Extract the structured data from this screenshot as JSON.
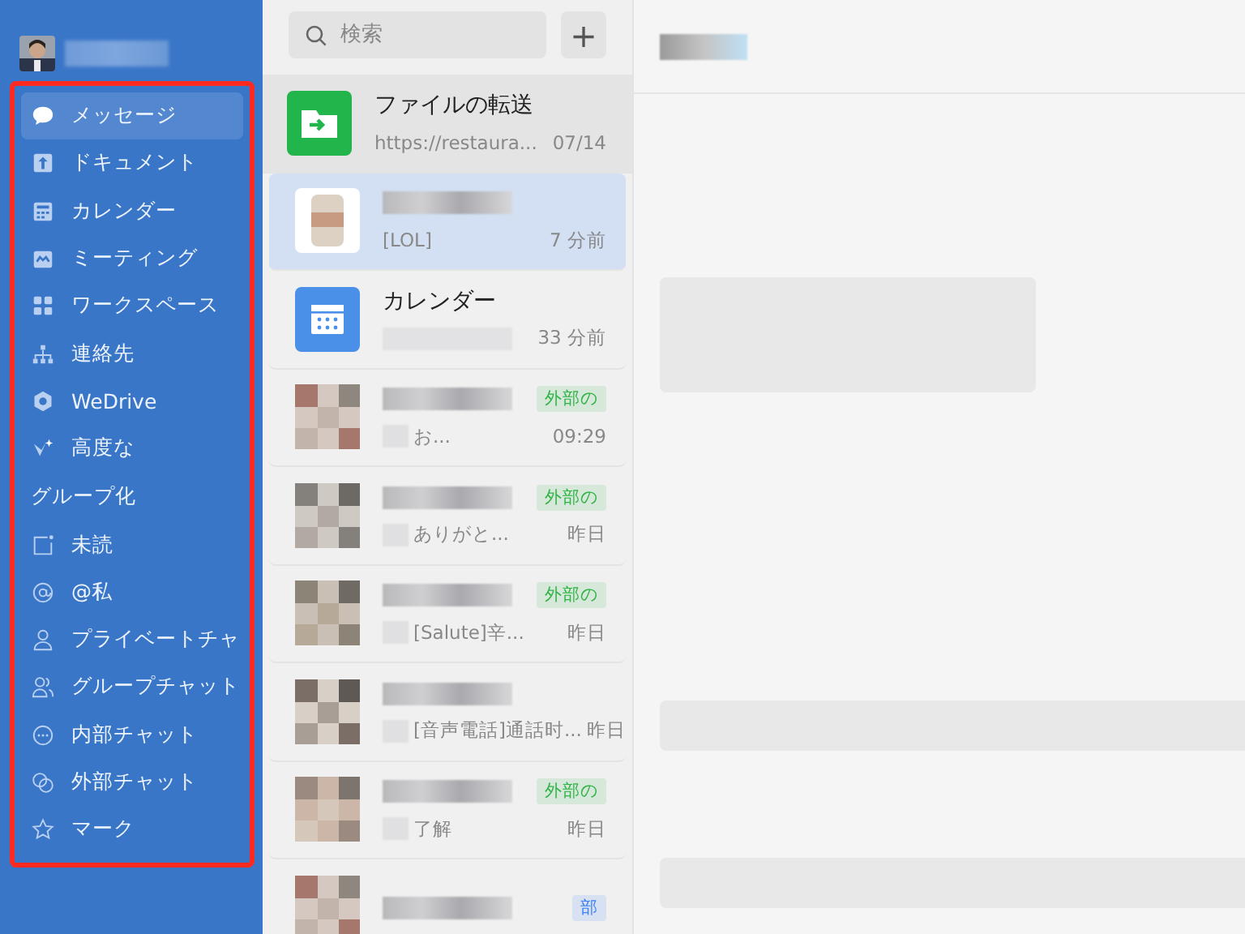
{
  "nav": [
    {
      "kind": "item",
      "label": "メッセージ",
      "selected": true
    },
    {
      "kind": "item",
      "label": "ドキュメント",
      "selected": false
    },
    {
      "kind": "item",
      "label": "カレンダー",
      "selected": false
    },
    {
      "kind": "item",
      "label": "ミーティング",
      "selected": false
    },
    {
      "kind": "item",
      "label": "ワークスペース",
      "selected": false
    },
    {
      "kind": "item",
      "label": "連絡先",
      "selected": false
    },
    {
      "kind": "item",
      "label": "WeDrive",
      "selected": false
    },
    {
      "kind": "item",
      "label": "高度な",
      "selected": false
    },
    {
      "kind": "heading",
      "label": "グループ化"
    },
    {
      "kind": "item",
      "label": "未読",
      "selected": false
    },
    {
      "kind": "item",
      "label": "@私",
      "selected": false
    },
    {
      "kind": "item",
      "label": "プライベートチャ",
      "selected": false
    },
    {
      "kind": "item",
      "label": "グループチャット",
      "selected": false
    },
    {
      "kind": "item",
      "label": "内部チャット",
      "selected": false
    },
    {
      "kind": "item",
      "label": "外部チャット",
      "selected": false
    },
    {
      "kind": "item",
      "label": "マーク",
      "selected": false
    }
  ],
  "search": {
    "placeholder": "検索",
    "add_button": "+"
  },
  "conversations": [
    {
      "kind": "file-app",
      "title": "ファイルの転送",
      "preview": "https://restaura...",
      "time": "07/14",
      "hovered": true,
      "selected": false
    },
    {
      "kind": "contact",
      "preview": "[LOL]",
      "time": "7 分前",
      "hovered": false,
      "selected": true
    },
    {
      "kind": "calendar-app",
      "title": "カレンダー",
      "time": "33 分前",
      "hovered": false,
      "selected": false
    },
    {
      "kind": "contact",
      "preview": "お...",
      "time": "09:29",
      "badge": "外部の",
      "color": "#2fb344",
      "hovered": false,
      "selected": false
    },
    {
      "kind": "contact",
      "preview": "ありがと...",
      "time": "昨日",
      "badge": "外部の",
      "color": "#2fb344",
      "hovered": false,
      "selected": false
    },
    {
      "kind": "contact",
      "preview": "[Salute]辛...",
      "time": "昨日",
      "badge": "外部の",
      "color": "#2fb344",
      "hovered": false,
      "selected": false
    },
    {
      "kind": "contact",
      "preview": "[音声電話]通話时...",
      "time": "昨日",
      "hovered": false,
      "selected": false
    },
    {
      "kind": "contact",
      "preview": "了解",
      "time": "昨日",
      "badge": "外部の",
      "color": "#2fb344",
      "hovered": false,
      "selected": false
    },
    {
      "kind": "contact",
      "badge": "部",
      "color": "#3b82f6",
      "hovered": false,
      "selected": false
    }
  ]
}
